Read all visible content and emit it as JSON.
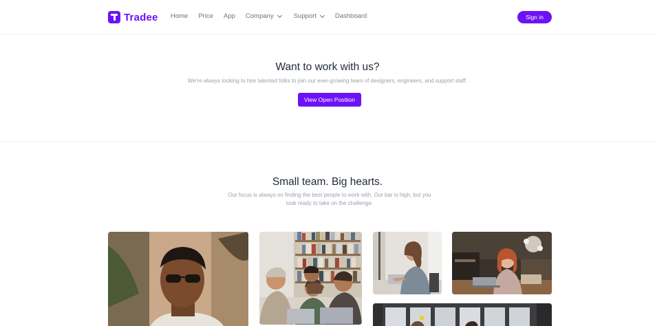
{
  "header": {
    "logo_text": "Tradee",
    "nav": [
      {
        "label": "Home",
        "dropdown": false
      },
      {
        "label": "Price",
        "dropdown": false
      },
      {
        "label": "App",
        "dropdown": false
      },
      {
        "label": "Company",
        "dropdown": true
      },
      {
        "label": "Support",
        "dropdown": true
      },
      {
        "label": "Dashboard",
        "dropdown": false
      }
    ],
    "signin_label": "Sign in"
  },
  "hero": {
    "title": "Want to work with us?",
    "subtitle": "We're always looking to hire talented folks to join our ever-growing team of designers, engineers, and support staff.",
    "button_label": "View Open Position"
  },
  "team": {
    "title": "Small team. Big hearts.",
    "subtitle": "Our focus is always on finding the best people to work with. Our bar is high, but you look ready to take on the challenge."
  },
  "colors": {
    "brand": "#6d12f5",
    "text_dark": "#1f2937",
    "text_muted": "#9aa0ab"
  }
}
